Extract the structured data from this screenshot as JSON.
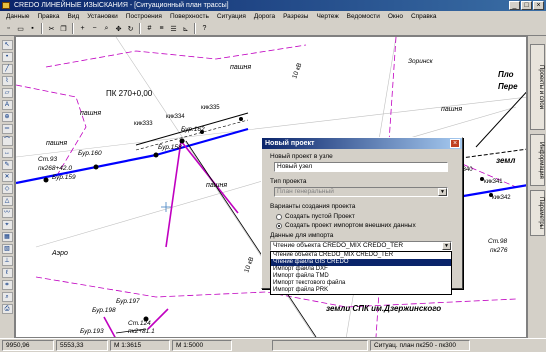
{
  "window": {
    "title": "CREDO ЛИНЕЙНЫЕ ИЗЫСКАНИЯ - [Ситуационный план трассы]"
  },
  "menu": [
    "Данные",
    "Правка",
    "Вид",
    "Установки",
    "Построения",
    "Поверхность",
    "Ситуация",
    "Дорога",
    "Разрезы",
    "Чертеж",
    "Ведомости",
    "Окно",
    "Справка"
  ],
  "map_labels": {
    "pk": "ПК 270+0,00",
    "pashnya": "пашня",
    "kik333": "кик333",
    "kik334": "кик334",
    "kik335": "кик335",
    "bur162": "Бур.162",
    "bur160": "Бур.160",
    "bur159": "Бур.159",
    "bur158": "Бур.158",
    "bur197": "Бур.197",
    "bur198": "Бур.198",
    "bur193": "Бур.193",
    "st93": "Ст.93",
    "pk268": "пк268+42.0",
    "st124": "Ст.124",
    "pk2": "пк2+81.1",
    "aero": "Аэро",
    "zorinsk": "Зоринск",
    "plosh": "Пло",
    "pere": "Пере",
    "zeml": "земл",
    "kik340": "кик340",
    "kik341": "кик341",
    "kik342": "кик342",
    "st98": "Ст.98",
    "pk276": "пк276",
    "ten_kv": "10 кВ",
    "land": "земли СПК им.Дзержинского"
  },
  "dialog": {
    "title": "Новый проект",
    "node_label": "Новый проект в узле",
    "node_value": "Новый узел",
    "type_label": "Тип проекта",
    "type_value": "План генеральный",
    "variants_label": "Варианты создания проекта",
    "radio_empty": "Создать пустой Проект",
    "radio_import": "Создать проект импортом внешних данных",
    "import_label": "Данные для импорта",
    "combo_value": "Чтение объекта CREDO_MIX CREDO_TER",
    "options": [
      "Чтение объекта CREDO_MIX CREDO_TER",
      "Чтение файла GIS CREDO",
      "Импорт файла DXF",
      "Импорт файла TMD",
      "Импорт текстового файла",
      "Импорт файла PRK"
    ],
    "selected_index": 1
  },
  "right_tabs": [
    "Проекты и слои",
    "Информация",
    "Параметры"
  ],
  "status": {
    "x": "9950,96",
    "y": "5553,33",
    "scale1": "М 1:3615",
    "scale2": "М 1:5000",
    "situation": "Ситуац. план пк250 - пк300"
  }
}
